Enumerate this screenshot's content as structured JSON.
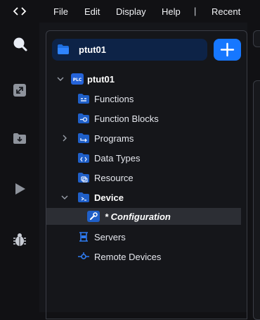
{
  "menubar": {
    "code_icon": "code-brackets-icon",
    "items": [
      "File",
      "Edit",
      "Display",
      "Help"
    ],
    "separator": "|",
    "recent": "Recent"
  },
  "activity_bar": {
    "icons": [
      "search-icon",
      "expand-icon",
      "download-icon",
      "play-icon",
      "bug-icon"
    ]
  },
  "project": {
    "name": "ptut01",
    "add_icon": "plus-icon"
  },
  "tree": {
    "root": {
      "badge": "PLC",
      "label": "ptut01"
    },
    "items": [
      {
        "label": "Functions"
      },
      {
        "label": "Function Blocks"
      },
      {
        "label": "Programs"
      },
      {
        "label": "Data Types"
      },
      {
        "label": "Resource"
      },
      {
        "label": "Device"
      },
      {
        "label": "* Configuration"
      },
      {
        "label": "Servers"
      },
      {
        "label": "Remote Devices"
      }
    ]
  },
  "colors": {
    "accent": "#1677ff",
    "project_bg": "#0d2347",
    "selected_row": "#2c2e34",
    "icon_blue": "#1f6fe0"
  }
}
